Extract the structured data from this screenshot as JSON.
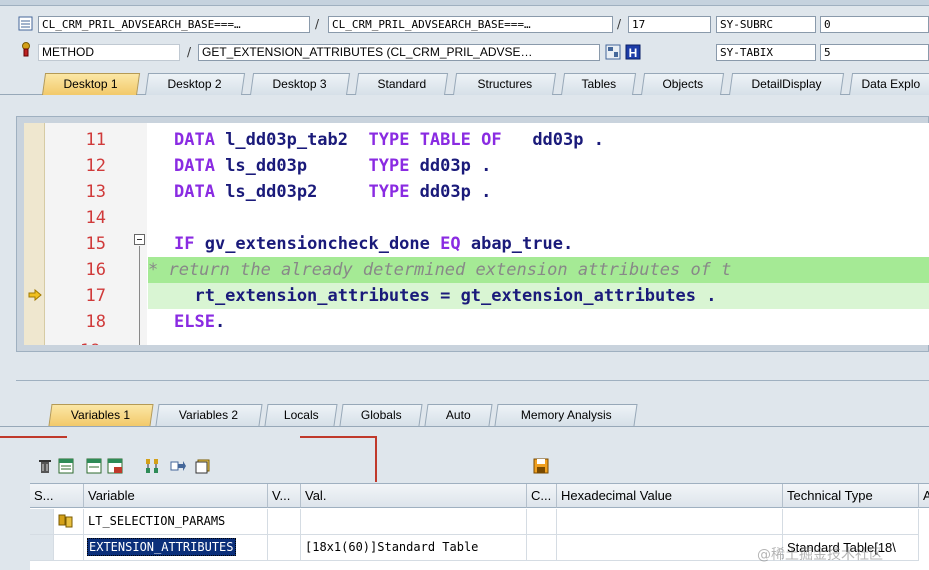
{
  "header": {
    "row1": {
      "program": "CL_CRM_PRIL_ADVSEARCH_BASE===…",
      "include": "CL_CRM_PRIL_ADVSEARCH_BASE===…",
      "line": "17",
      "sysvar_label": "SY-SUBRC",
      "sysvar_value": "0"
    },
    "row2": {
      "type": "METHOD",
      "event": "GET_EXTENSION_ATTRIBUTES (CL_CRM_PRIL_ADVSE…",
      "sysvar_label": "SY-TABIX",
      "sysvar_value": "5"
    },
    "separator": "/"
  },
  "desktop_tabs": [
    "Desktop 1",
    "Desktop 2",
    "Desktop 3",
    "Standard",
    "Structures",
    "Tables",
    "Objects",
    "DetailDisplay",
    "Data Explo"
  ],
  "code": {
    "lines": [
      {
        "num": "11",
        "text": "DATA l_dd03p_tab2  TYPE TABLE OF   dd03p ."
      },
      {
        "num": "12",
        "text": "DATA ls_dd03p      TYPE dd03p ."
      },
      {
        "num": "13",
        "text": "DATA ls_dd03p2     TYPE dd03p ."
      },
      {
        "num": "14",
        "text": ""
      },
      {
        "num": "15",
        "text": "IF gv_extensioncheck_done EQ abap_true."
      },
      {
        "num": "16",
        "text": "* return the already determined extension attributes of t"
      },
      {
        "num": "17",
        "text": "  rt_extension_attributes = gt_extension_attributes ."
      },
      {
        "num": "18",
        "text": "ELSE."
      }
    ]
  },
  "var_tabs": [
    "Variables 1",
    "Variables 2",
    "Locals",
    "Globals",
    "Auto",
    "Memory Analysis"
  ],
  "table": {
    "headers": [
      "S...",
      "Variable",
      "V...",
      "Val.",
      "C...",
      "Hexadecimal Value",
      "Technical Type",
      "A"
    ],
    "rows": [
      {
        "variable": "LT_SELECTION_PARAMS",
        "val": "",
        "tech": ""
      },
      {
        "variable": "EXTENSION_ATTRIBUTES",
        "val": "[18x1(60)]Standard Table",
        "tech": "Standard Table[18\\"
      }
    ]
  },
  "watermark": "@稀土掘金技术社区",
  "colors": {
    "active_tab": "#f2c96a",
    "comment_highlight": "#a5ea95",
    "current_line": "#d9f5d3",
    "line_numbers": "#d03a3a",
    "annotation_line": "#c0392b"
  }
}
